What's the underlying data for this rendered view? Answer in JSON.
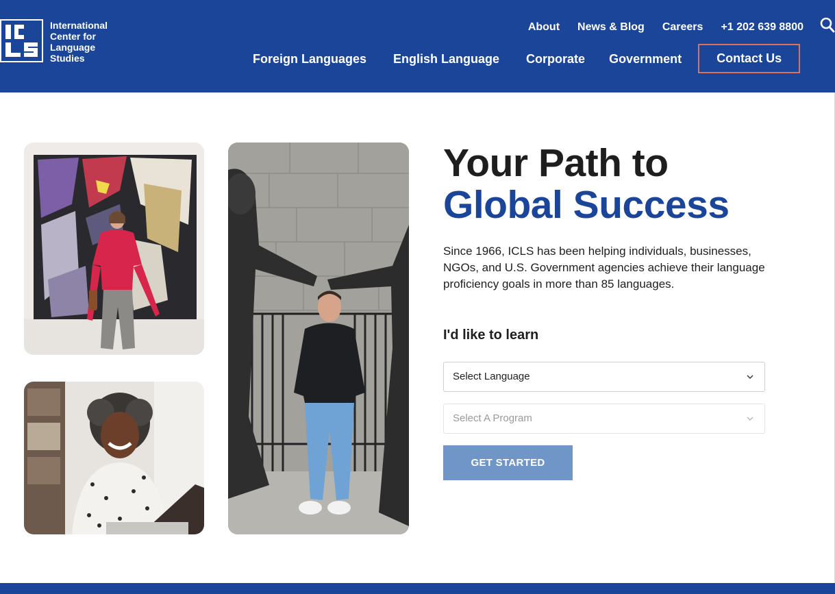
{
  "brand": {
    "logo_lines": [
      "International",
      "Center for",
      "Language",
      "Studies"
    ],
    "logo_mark": "ICLS"
  },
  "top_links": [
    {
      "label": "About"
    },
    {
      "label": "News & Blog"
    },
    {
      "label": "Careers"
    },
    {
      "label": "+1 202 639 8800"
    }
  ],
  "search_icon": "search-icon",
  "main_nav": [
    {
      "label": "Foreign Languages"
    },
    {
      "label": "English Language"
    },
    {
      "label": "Corporate"
    },
    {
      "label": "Government"
    }
  ],
  "contact_button": "Contact Us",
  "hero": {
    "title_line1": "Your Path to",
    "title_line2": "Global Success",
    "description": "Since 1966, ICLS has been helping individuals, businesses, NGOs, and U.S. Government agencies achieve their language proficiency goals in more than 85 languages.",
    "learn_label": "I'd like to learn",
    "language_select": "Select Language",
    "program_select": "Select A Program",
    "cta": "GET STARTED"
  },
  "colors": {
    "brand_blue": "#1a4598",
    "cta_blue": "#7096c8",
    "contact_border": "#e0705a"
  }
}
